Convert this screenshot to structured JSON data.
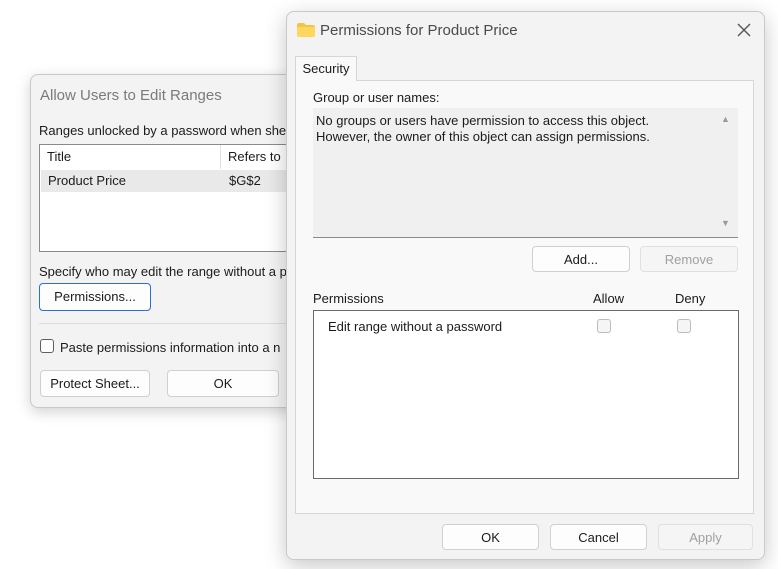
{
  "back_dialog": {
    "title": "Allow Users to Edit Ranges",
    "ranges_label": "Ranges unlocked by a password when she",
    "columns": [
      "Title",
      "Refers to"
    ],
    "rows": [
      {
        "title": "Product Price",
        "refers_to": "$G$2"
      }
    ],
    "specify_text": "Specify who may edit the range without a p",
    "permissions_button": "Permissions...",
    "paste_checkbox_label": "Paste permissions information into a n",
    "protect_sheet_button": "Protect Sheet...",
    "ok_button": "OK"
  },
  "front_dialog": {
    "title": "Permissions for Product Price",
    "tab": "Security",
    "group_label": "Group or user names:",
    "names_message_line1": "No groups or users have permission to access this object.",
    "names_message_line2": "However, the owner of this object can assign permissions.",
    "add_button": "Add...",
    "remove_button": "Remove",
    "permissions_label": "Permissions",
    "allow_label": "Allow",
    "deny_label": "Deny",
    "permission_rows": [
      {
        "label": "Edit range without a password",
        "allow": false,
        "deny": false
      }
    ],
    "ok_button": "OK",
    "cancel_button": "Cancel",
    "apply_button": "Apply"
  },
  "icons": {
    "folder": "folder-icon",
    "close": "close-icon",
    "scroll_up": "scroll-up-icon",
    "scroll_down": "scroll-down-icon"
  },
  "colors": {
    "accent": "#2a6fd1",
    "folder": "#f4c542"
  }
}
